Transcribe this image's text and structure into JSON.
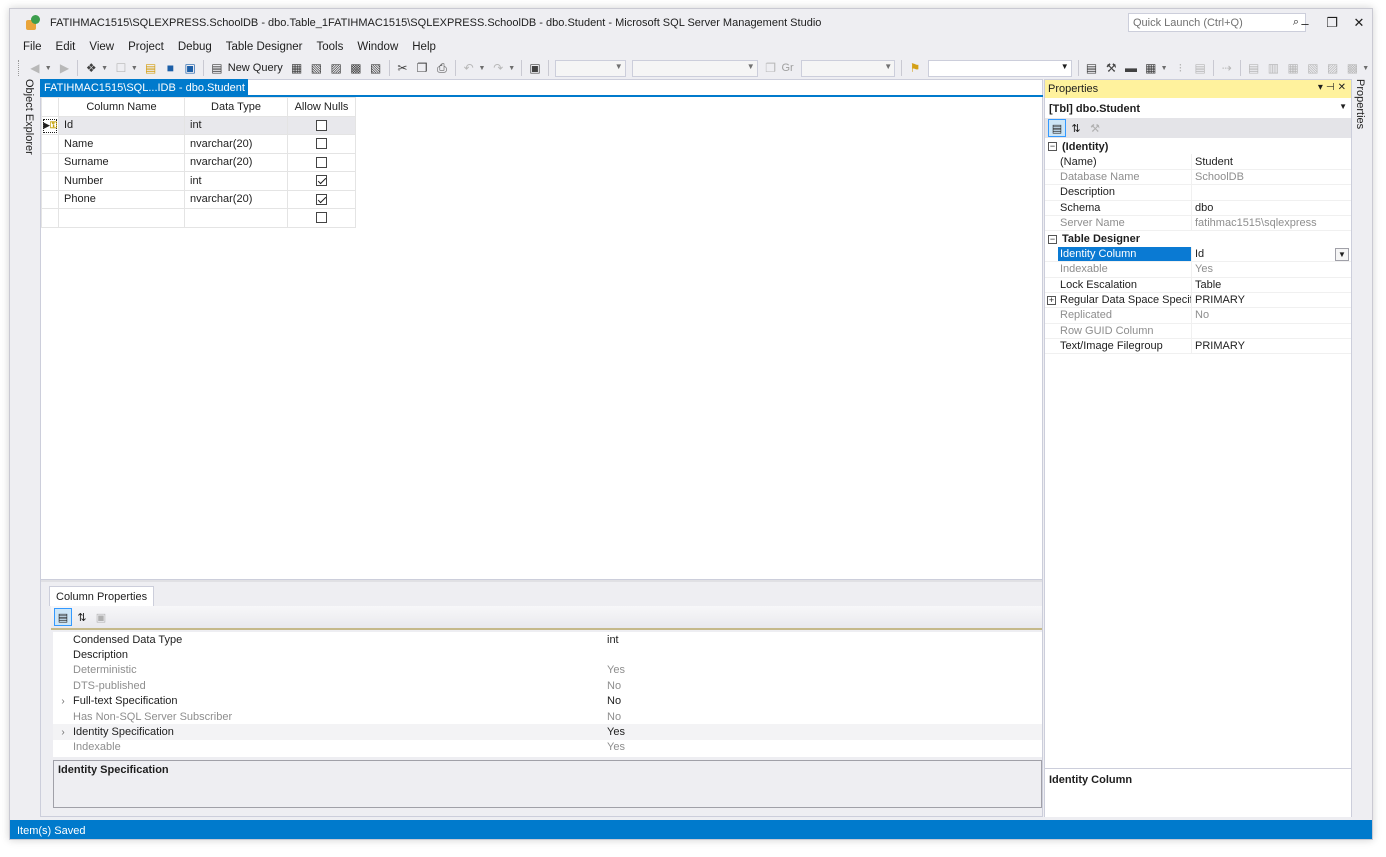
{
  "window": {
    "title": "FATIHMAC1515\\SQLEXPRESS.SchoolDB - dbo.Table_1FATIHMAC1515\\SQLEXPRESS.SchoolDB - dbo.Student - Microsoft SQL Server Management Studio",
    "quick_launch_placeholder": "Quick Launch (Ctrl+Q)"
  },
  "menu": [
    "File",
    "Edit",
    "View",
    "Project",
    "Debug",
    "Table Designer",
    "Tools",
    "Window",
    "Help"
  ],
  "toolbar": {
    "new_query_label": "New Query",
    "combo_text": "Gr"
  },
  "side_tabs": {
    "left": "Object Explorer",
    "right": "Properties"
  },
  "document_tab": {
    "label": "FATIHMAC1515\\SQL...IDB - dbo.Student"
  },
  "table_designer": {
    "headers": [
      "Column Name",
      "Data Type",
      "Allow Nulls"
    ],
    "rows": [
      {
        "name": "Id",
        "type": "int",
        "allow_nulls": false,
        "primary_key": true
      },
      {
        "name": "Name",
        "type": "nvarchar(20)",
        "allow_nulls": false
      },
      {
        "name": "Surname",
        "type": "nvarchar(20)",
        "allow_nulls": false
      },
      {
        "name": "Number",
        "type": "int",
        "allow_nulls": true
      },
      {
        "name": "Phone",
        "type": "nvarchar(20)",
        "allow_nulls": true
      },
      {
        "name": "",
        "type": "",
        "allow_nulls": false
      }
    ]
  },
  "column_properties": {
    "tab_label": "Column Properties",
    "rows": [
      {
        "name": "Condensed Data Type",
        "value": "int",
        "dim": false,
        "expandable": false
      },
      {
        "name": "Description",
        "value": "",
        "dim": false,
        "expandable": false
      },
      {
        "name": "Deterministic",
        "value": "Yes",
        "dim": true,
        "expandable": false
      },
      {
        "name": "DTS-published",
        "value": "No",
        "dim": true,
        "expandable": false
      },
      {
        "name": "Full-text Specification",
        "value": "No",
        "dim": false,
        "expandable": true
      },
      {
        "name": "Has Non-SQL Server Subscriber",
        "value": "No",
        "dim": true,
        "expandable": false
      },
      {
        "name": "Identity Specification",
        "value": "Yes",
        "dim": false,
        "expandable": true,
        "highlight": true
      },
      {
        "name": "Indexable",
        "value": "Yes",
        "dim": true,
        "expandable": false
      }
    ],
    "description_title": "Identity Specification"
  },
  "properties_panel": {
    "title": "Properties",
    "object": "[Tbl] dbo.Student",
    "categories": [
      {
        "name": "(Identity)",
        "rows": [
          {
            "name": "(Name)",
            "value": "Student",
            "dim": false
          },
          {
            "name": "Database Name",
            "value": "SchoolDB",
            "dim": true
          },
          {
            "name": "Description",
            "value": "",
            "dim": false
          },
          {
            "name": "Schema",
            "value": "dbo",
            "dim": false
          },
          {
            "name": "Server Name",
            "value": "fatihmac1515\\sqlexpress",
            "dim": true
          }
        ]
      },
      {
        "name": "Table Designer",
        "rows": [
          {
            "name": "Identity Column",
            "value": "Id",
            "dim": false,
            "selected": true
          },
          {
            "name": "Indexable",
            "value": "Yes",
            "dim": true
          },
          {
            "name": "Lock Escalation",
            "value": "Table",
            "dim": false
          },
          {
            "name": "Regular Data Space Specification",
            "value": "PRIMARY",
            "dim": false,
            "expandable": true
          },
          {
            "name": "Replicated",
            "value": "No",
            "dim": true
          },
          {
            "name": "Row GUID Column",
            "value": "",
            "dim": true
          },
          {
            "name": "Text/Image Filegroup",
            "value": "PRIMARY",
            "dim": false
          }
        ]
      }
    ],
    "description_title": "Identity Column"
  },
  "status_bar": {
    "text": "Item(s) Saved"
  },
  "colors": {
    "accent": "#007acc",
    "properties_header": "#fff29d",
    "selection": "#0a7ad3"
  }
}
